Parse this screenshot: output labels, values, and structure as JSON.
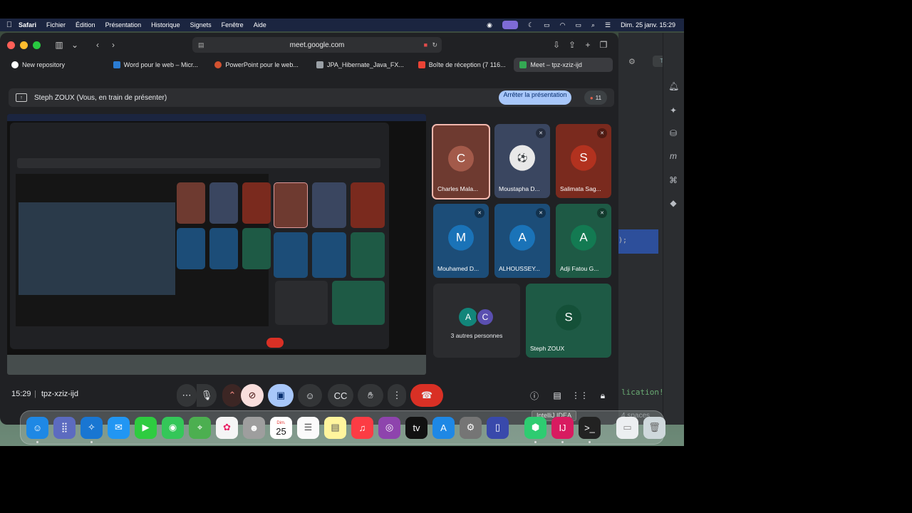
{
  "menubar": {
    "app": "Safari",
    "items": [
      "Fichier",
      "Édition",
      "Présentation",
      "Historique",
      "Signets",
      "Fenêtre",
      "Aide"
    ],
    "datetime": "Dim. 25 janv.  15:29"
  },
  "browser": {
    "url": "meet.google.com",
    "tabs": [
      {
        "label": "New repository",
        "color": "#ffffff"
      },
      {
        "label": "Word pour le web – Micr...",
        "color": "#2b7cd3"
      },
      {
        "label": "PowerPoint pour le web...",
        "color": "#d35230"
      },
      {
        "label": "JPA_Hibernate_Java_FX...",
        "color": "#9aa0a6"
      },
      {
        "label": "Boîte de réception (7 116...",
        "color": "#ea4335"
      },
      {
        "label": "Meet – tpz-xziz-ijd",
        "color": "#34a853"
      }
    ]
  },
  "presenting_bar": {
    "text": "Steph ZOUX (Vous, en train de présenter)",
    "stop_button": "Arrêter la présentation",
    "participant_count": "11"
  },
  "participants": [
    {
      "name": "Charles Mala...",
      "initial": "C",
      "muted": false,
      "bg": "#6e3a30",
      "avatar_bg": "#a35a4a"
    },
    {
      "name": "Moustapha D...",
      "initial": "",
      "muted": true,
      "bg": "#3a4660",
      "avatar_bg": "#e8e8e8"
    },
    {
      "name": "Salimata Sag...",
      "initial": "S",
      "muted": true,
      "bg": "#7a2a1e",
      "avatar_bg": "#b2321f"
    },
    {
      "name": "Mouhamed D...",
      "initial": "M",
      "muted": true,
      "bg": "#1c4d78",
      "avatar_bg": "#1a73b8"
    },
    {
      "name": "ALHOUSSEY...",
      "initial": "A",
      "muted": true,
      "bg": "#1c4d78",
      "avatar_bg": "#1a73b8"
    },
    {
      "name": "Adji Fatou G...",
      "initial": "A",
      "muted": true,
      "bg": "#1e5a45",
      "avatar_bg": "#137a52"
    }
  ],
  "others_tile": {
    "label": "3 autres personnes",
    "initials": [
      "A",
      "C"
    ]
  },
  "self_tile": {
    "name": "Steph ZOUX",
    "initial": "S"
  },
  "meeting": {
    "time": "15:29",
    "code": "tpz-xziz-ijd",
    "tooltip": "IntelliJ IDEA"
  },
  "ide": {
    "trial": "Trial",
    "code_fragment": ");",
    "green_text": "lication!",
    "spaces": "4 spaces"
  },
  "dock": {
    "calendar_month": "Dim.",
    "calendar_day": "25"
  }
}
